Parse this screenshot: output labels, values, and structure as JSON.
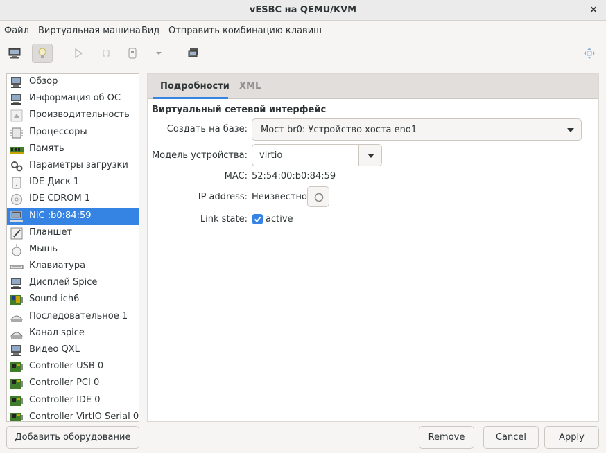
{
  "window": {
    "title": "vESBC на QEMU/KVM",
    "close_glyph": "×"
  },
  "menu": [
    "Файл",
    "Виртуальная машина",
    "Вид",
    "Отправить комбинацию клавиш"
  ],
  "toolbar": {
    "buttons": [
      "monitor-icon",
      "lightbulb-icon",
      "play-icon",
      "pause-icon",
      "stop-icon",
      "dropdown-arrow-icon",
      "snapshots-icon",
      "fullscreen-icon"
    ]
  },
  "sidebar": {
    "items": [
      {
        "label": "Обзор",
        "icon": "overview-icon"
      },
      {
        "label": "Информация об ОС",
        "icon": "os-info-icon"
      },
      {
        "label": "Производительность",
        "icon": "performance-icon"
      },
      {
        "label": "Процессоры",
        "icon": "cpu-icon"
      },
      {
        "label": "Память",
        "icon": "memory-icon"
      },
      {
        "label": "Параметры загрузки",
        "icon": "boot-options-icon"
      },
      {
        "label": "IDE Диск 1",
        "icon": "disk-icon"
      },
      {
        "label": "IDE CDROM 1",
        "icon": "cdrom-icon"
      },
      {
        "label": "NIC :b0:84:59",
        "icon": "nic-icon"
      },
      {
        "label": "Планшет",
        "icon": "tablet-icon"
      },
      {
        "label": "Мышь",
        "icon": "mouse-icon"
      },
      {
        "label": "Клавиатура",
        "icon": "keyboard-icon"
      },
      {
        "label": "Дисплей Spice",
        "icon": "display-icon"
      },
      {
        "label": "Sound ich6",
        "icon": "sound-icon"
      },
      {
        "label": "Последовательное 1",
        "icon": "serial-icon"
      },
      {
        "label": "Канал spice",
        "icon": "channel-icon"
      },
      {
        "label": "Видео QXL",
        "icon": "video-icon"
      },
      {
        "label": "Controller USB 0",
        "icon": "controller-icon"
      },
      {
        "label": "Controller PCI 0",
        "icon": "controller-icon"
      },
      {
        "label": "Controller IDE 0",
        "icon": "controller-icon"
      },
      {
        "label": "Controller VirtIO Serial 0",
        "icon": "controller-icon"
      }
    ],
    "selected_index": 8
  },
  "tabs": {
    "details": "Подробности",
    "xml": "XML"
  },
  "nic": {
    "section_title": "Виртуальный сетевой интерфейс",
    "source_label": "Создать на базе:",
    "source_value": "Мост br0: Устройство хоста eno1",
    "model_label": "Модель устройства:",
    "model_value": "virtio",
    "mac_label": "MAC:",
    "mac_value": "52:54:00:b0:84:59",
    "ip_label": "IP address:",
    "ip_value": "Неизвестно",
    "link_label": "Link state:",
    "link_value": "active",
    "link_checked": true
  },
  "buttons": {
    "add_hardware": "Добавить оборудование",
    "remove": "Remove",
    "cancel": "Cancel",
    "apply": "Apply"
  },
  "colors": {
    "accent": "#3584e4",
    "window_bg": "#f6f5f4",
    "controller_green": "#3f7d2b"
  }
}
